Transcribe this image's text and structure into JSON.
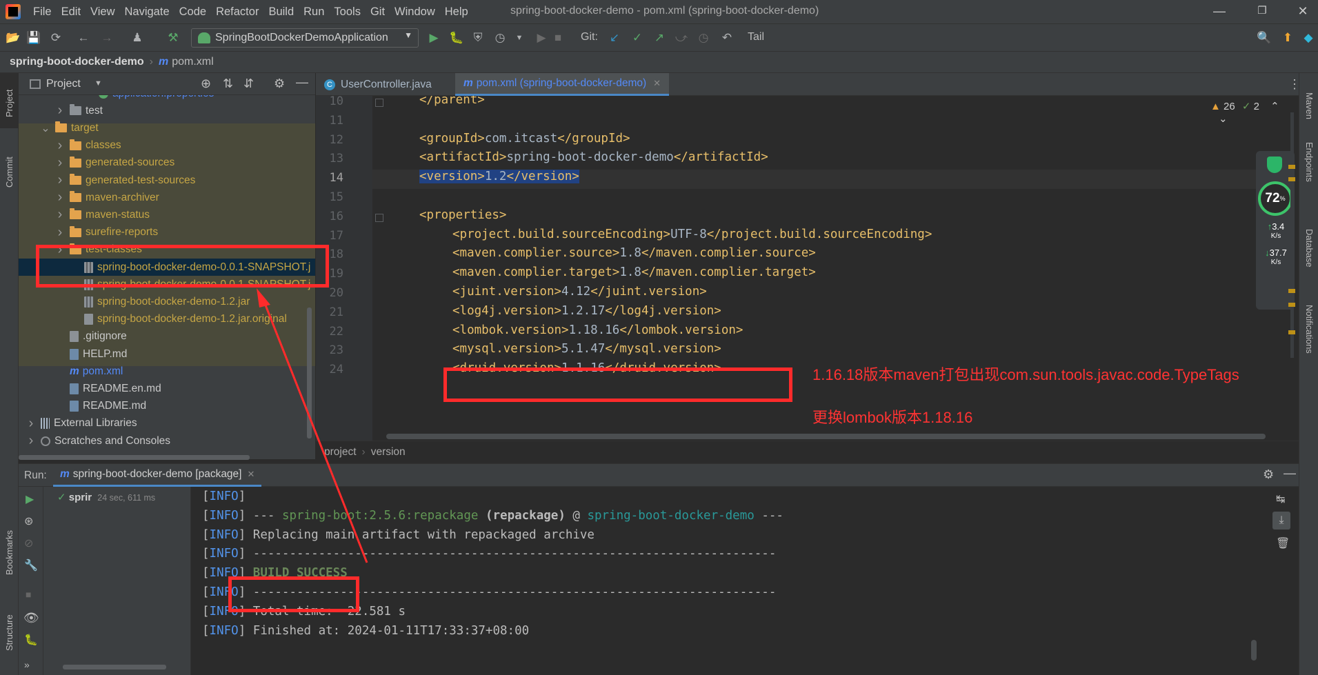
{
  "window": {
    "title": "spring-boot-docker-demo - pom.xml (spring-boot-docker-demo)"
  },
  "menu": [
    "File",
    "Edit",
    "View",
    "Navigate",
    "Code",
    "Refactor",
    "Build",
    "Run",
    "Tools",
    "Git",
    "Window",
    "Help"
  ],
  "toolbar": {
    "run_config": "SpringBootDockerDemoApplication",
    "git_label": "Git:",
    "tail_label": "Tail"
  },
  "breadcrumb": {
    "project": "spring-boot-docker-demo",
    "file": "pom.xml"
  },
  "left_stripe": {
    "project": "Project",
    "commit": "Commit",
    "bookmarks": "Bookmarks",
    "structure": "Structure"
  },
  "right_stripe": {
    "maven": "Maven",
    "endpoints": "Endpoints",
    "database": "Database",
    "notifications": "Notifications"
  },
  "project_panel": {
    "title": "Project",
    "tree": [
      {
        "label": "application.properties",
        "indent": 5,
        "kind": "props"
      },
      {
        "label": "test",
        "indent": 3,
        "kind": "folder-gray",
        "chev": "right"
      },
      {
        "label": "target",
        "indent": 2,
        "kind": "folder",
        "chev": "down"
      },
      {
        "label": "classes",
        "indent": 3,
        "kind": "folder",
        "chev": "right"
      },
      {
        "label": "generated-sources",
        "indent": 3,
        "kind": "folder",
        "chev": "right"
      },
      {
        "label": "generated-test-sources",
        "indent": 3,
        "kind": "folder",
        "chev": "right"
      },
      {
        "label": "maven-archiver",
        "indent": 3,
        "kind": "folder",
        "chev": "right"
      },
      {
        "label": "maven-status",
        "indent": 3,
        "kind": "folder",
        "chev": "right"
      },
      {
        "label": "surefire-reports",
        "indent": 3,
        "kind": "folder",
        "chev": "right"
      },
      {
        "label": "test-classes",
        "indent": 3,
        "kind": "folder",
        "chev": "right"
      },
      {
        "label": "spring-boot-docker-demo-0.0.1-SNAPSHOT.j",
        "indent": 4,
        "kind": "jar",
        "selected": true
      },
      {
        "label": "spring-boot-docker-demo-0.0.1-SNAPSHOT.j",
        "indent": 4,
        "kind": "jar"
      },
      {
        "label": "spring-boot-docker-demo-1.2.jar",
        "indent": 4,
        "kind": "jar"
      },
      {
        "label": "spring-boot-docker-demo-1.2.jar.original",
        "indent": 4,
        "kind": "file"
      },
      {
        "label": ".gitignore",
        "indent": 3,
        "kind": "file"
      },
      {
        "label": "HELP.md",
        "indent": 3,
        "kind": "md"
      },
      {
        "label": "pom.xml",
        "indent": 3,
        "kind": "pom"
      },
      {
        "label": "README.en.md",
        "indent": 3,
        "kind": "md"
      },
      {
        "label": "README.md",
        "indent": 3,
        "kind": "md"
      },
      {
        "label": "External Libraries",
        "indent": 1,
        "kind": "lib",
        "chev": "right"
      },
      {
        "label": "Scratches and Consoles",
        "indent": 1,
        "kind": "scratch",
        "chev": "right"
      }
    ]
  },
  "editor": {
    "tabs": [
      {
        "label": "UserController.java",
        "icon": "C",
        "active": false
      },
      {
        "label": "pom.xml (spring-boot-docker-demo)",
        "icon": "m",
        "active": true
      }
    ],
    "inspections": {
      "warnings": "26",
      "weak": "2"
    },
    "lines": [
      {
        "n": "10",
        "indent": 0,
        "open": "</parent>",
        "text": "",
        "close": ""
      },
      {
        "n": "11",
        "indent": 0,
        "open": "",
        "text": "",
        "close": ""
      },
      {
        "n": "12",
        "indent": 0,
        "open": "<groupId>",
        "text": "com.itcast",
        "close": "</groupId>"
      },
      {
        "n": "13",
        "indent": 0,
        "open": "<artifactId>",
        "text": "spring-boot-docker-demo",
        "close": "</artifactId>"
      },
      {
        "n": "14",
        "indent": 0,
        "open": "<version>",
        "text": "1.2",
        "close": "</version>",
        "highlight": true
      },
      {
        "n": "15",
        "indent": 0,
        "open": "",
        "text": "",
        "close": ""
      },
      {
        "n": "16",
        "indent": 0,
        "open": "<properties>",
        "text": "",
        "close": ""
      },
      {
        "n": "17",
        "indent": 1,
        "open": "<project.build.sourceEncoding>",
        "text": "UTF-8",
        "close": "</project.build.sourceEncoding>"
      },
      {
        "n": "18",
        "indent": 1,
        "open": "<maven.complier.source>",
        "text": "1.8",
        "close": "</maven.complier.source>"
      },
      {
        "n": "19",
        "indent": 1,
        "open": "<maven.complier.target>",
        "text": "1.8",
        "close": "</maven.complier.target>"
      },
      {
        "n": "20",
        "indent": 1,
        "open": "<juint.version>",
        "text": "4.12",
        "close": "</juint.version>"
      },
      {
        "n": "21",
        "indent": 1,
        "open": "<log4j.version>",
        "text": "1.2.17",
        "close": "</log4j.version>"
      },
      {
        "n": "22",
        "indent": 1,
        "open": "<lombok.version>",
        "text": "1.18.16",
        "close": "</lombok.version>"
      },
      {
        "n": "23",
        "indent": 1,
        "open": "<mysql.version>",
        "text": "5.1.47",
        "close": "</mysql.version>"
      },
      {
        "n": "24",
        "indent": 1,
        "open": "<druid.version>",
        "text": "1.1.16",
        "close": "</druid.version>"
      }
    ],
    "crumbs": [
      "project",
      "version"
    ]
  },
  "widget": {
    "percent": "72",
    "up_rate": "3.4",
    "up_unit": "K/s",
    "down_rate": "37.7",
    "down_unit": "K/s",
    "pct_sign": "%"
  },
  "run_panel": {
    "label": "Run:",
    "tab": "spring-boot-docker-demo [package]",
    "tree_item": "sprir",
    "tree_time": "24 sec, 611 ms",
    "console": [
      {
        "tag": "[INFO]",
        "parts": []
      },
      {
        "tag": "[INFO]",
        "parts": [
          {
            "t": " --- ",
            "c": ""
          },
          {
            "t": "spring-boot:2.5.6:repackage",
            "c": "grn"
          },
          {
            "t": " (repackage)",
            "c": "bold"
          },
          {
            "t": " @ ",
            "c": ""
          },
          {
            "t": "spring-boot-docker-demo",
            "c": "cyan"
          },
          {
            "t": " ---",
            "c": ""
          }
        ]
      },
      {
        "tag": "[INFO]",
        "parts": [
          {
            "t": " Replacing main artifact with repackaged archive",
            "c": ""
          }
        ]
      },
      {
        "tag": "[INFO]",
        "parts": [
          {
            "t": " ------------------------------------------------------------------------",
            "c": ""
          }
        ]
      },
      {
        "tag": "[INFO]",
        "parts": [
          {
            "t": " BUILD SUCCESS",
            "c": "ok bold"
          }
        ]
      },
      {
        "tag": "[INFO]",
        "parts": [
          {
            "t": " ------------------------------------------------------------------------",
            "c": ""
          }
        ]
      },
      {
        "tag": "[INFO]",
        "parts": [
          {
            "t": " Total time:  22.581 s",
            "c": ""
          }
        ]
      },
      {
        "tag": "[INFO]",
        "parts": [
          {
            "t": " Finished at: 2024-01-11T17:33:37+08:00",
            "c": ""
          }
        ]
      }
    ]
  },
  "annotations": {
    "note1": "1.16.18版本maven打包出现com.sun.tools.javac.code.TypeTags",
    "note2": "更换lombok版本1.18.16",
    "color": "#ff2b2b"
  }
}
